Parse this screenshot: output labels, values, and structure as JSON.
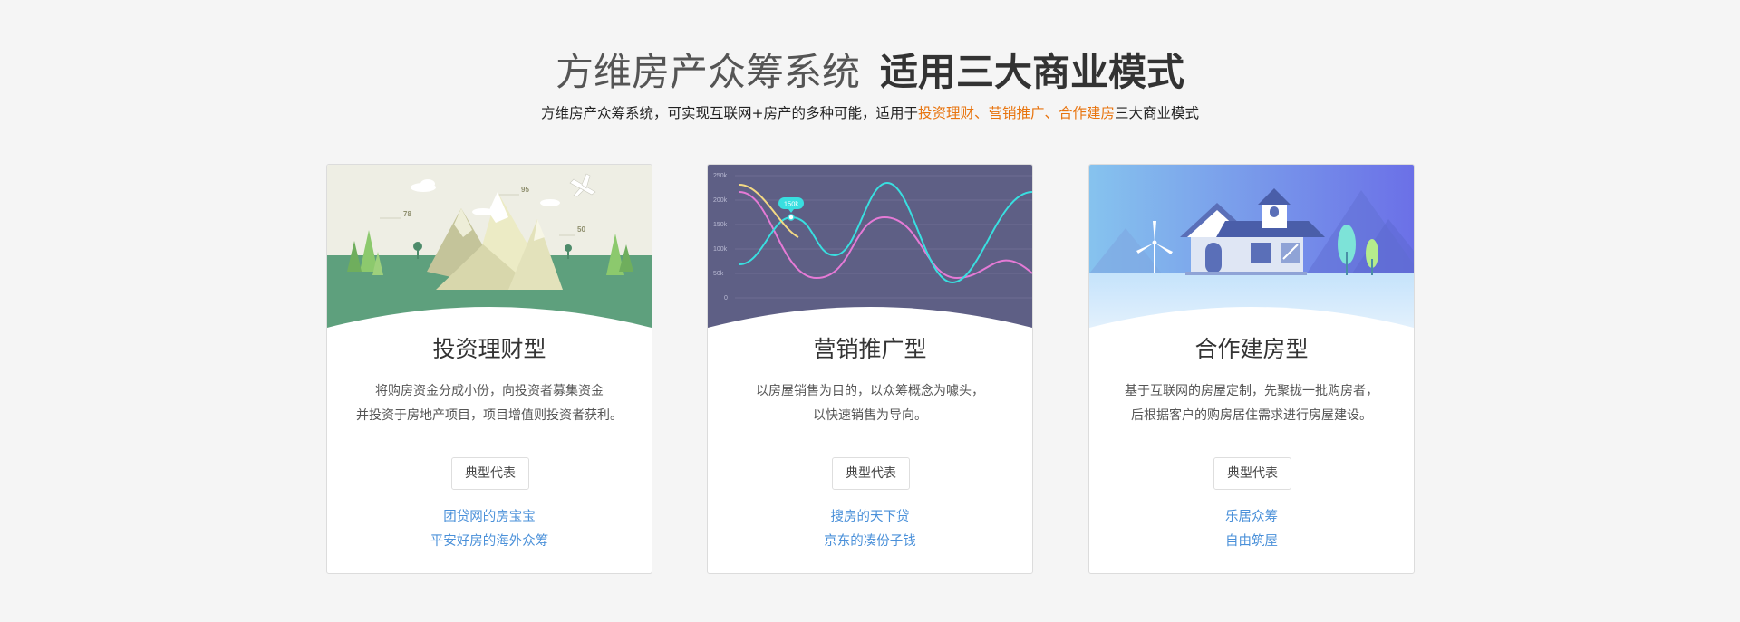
{
  "header": {
    "title_light": "方维房产众筹系统",
    "title_bold": "适用三大商业模式",
    "subtitle_prefix": "方维房产众筹系统，可实现互联网+房产的多种可能，适用于",
    "subtitle_highlight": "投资理财、营销推广、合作建房",
    "subtitle_suffix": "三大商业模式",
    "highlight_color": "#e8740e"
  },
  "cards": [
    {
      "title": "投资理财型",
      "desc_line1": "将购房资金分成小份，向投资者募集资金",
      "desc_line2": "并投资于房地产项目，项目增值则投资者获利。",
      "tag": "典型代表",
      "link1": "团贷网的房宝宝",
      "link2": "平安好房的海外众筹",
      "illustration": {
        "labels": [
          "95",
          "78",
          "50"
        ]
      }
    },
    {
      "title": "营销推广型",
      "desc_line1": "以房屋销售为目的，以众筹概念为噱头，",
      "desc_line2": "以快速销售为导向。",
      "tag": "典型代表",
      "link1": "搜房的天下贷",
      "link2": "京东的凑份子钱",
      "illustration": {
        "y_ticks": [
          "250k",
          "200k",
          "150k",
          "100k",
          "50k",
          "0"
        ],
        "bubble": "150k"
      }
    },
    {
      "title": "合作建房型",
      "desc_line1": "基于互联网的房屋定制，先聚拢一批购房者，",
      "desc_line2": "后根据客户的购房居住需求进行房屋建设。",
      "tag": "典型代表",
      "link1": "乐居众筹",
      "link2": "自由筑屋"
    }
  ],
  "colors": {
    "link": "#4a90d9",
    "mountain_bg": "#eeeee4",
    "mountain_ground": "#5ea07d",
    "chart_bg": "#5e5f85",
    "chart_cyan": "#39dfe0",
    "chart_pink": "#e57ad6",
    "chart_yellow": "#f3d983",
    "house_sky_start": "#86c3ee",
    "house_sky_end": "#6b70e7"
  }
}
